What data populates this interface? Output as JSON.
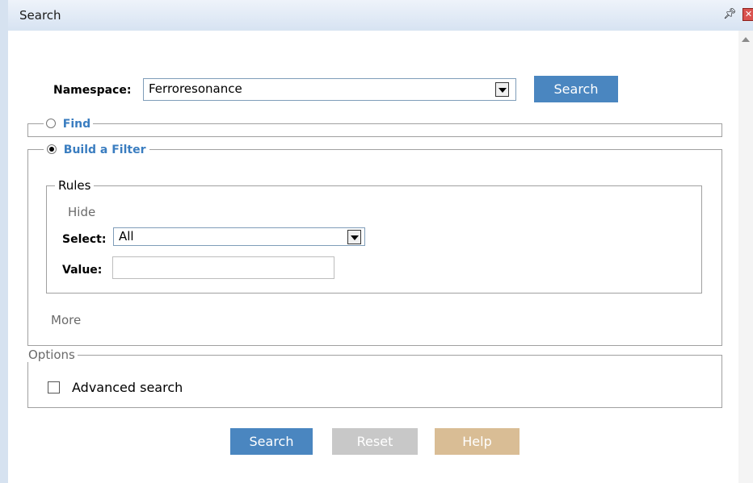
{
  "window": {
    "title": "Search"
  },
  "namespace": {
    "label": "Namespace:",
    "value": "Ferroresonance",
    "button": "Search"
  },
  "find": {
    "label": "Find",
    "selected": false
  },
  "filter": {
    "label": "Build a Filter",
    "selected": true,
    "rules": {
      "legend": "Rules",
      "hide_link": "Hide",
      "select_label": "Select:",
      "select_value": "All",
      "value_label": "Value:",
      "value": ""
    },
    "more_link": "More"
  },
  "options": {
    "legend": "Options",
    "advanced_label": "Advanced search",
    "advanced_checked": false
  },
  "buttons": {
    "search": "Search",
    "reset": "Reset",
    "help": "Help"
  },
  "icons": {
    "pin": "pin-icon",
    "close": "close-icon"
  },
  "colors": {
    "primary": "#4a86c0",
    "disabled": "#c8c8c8",
    "help": "#d9bd95",
    "link": "#3a7dc0",
    "titlebar": "#dde8f5"
  }
}
